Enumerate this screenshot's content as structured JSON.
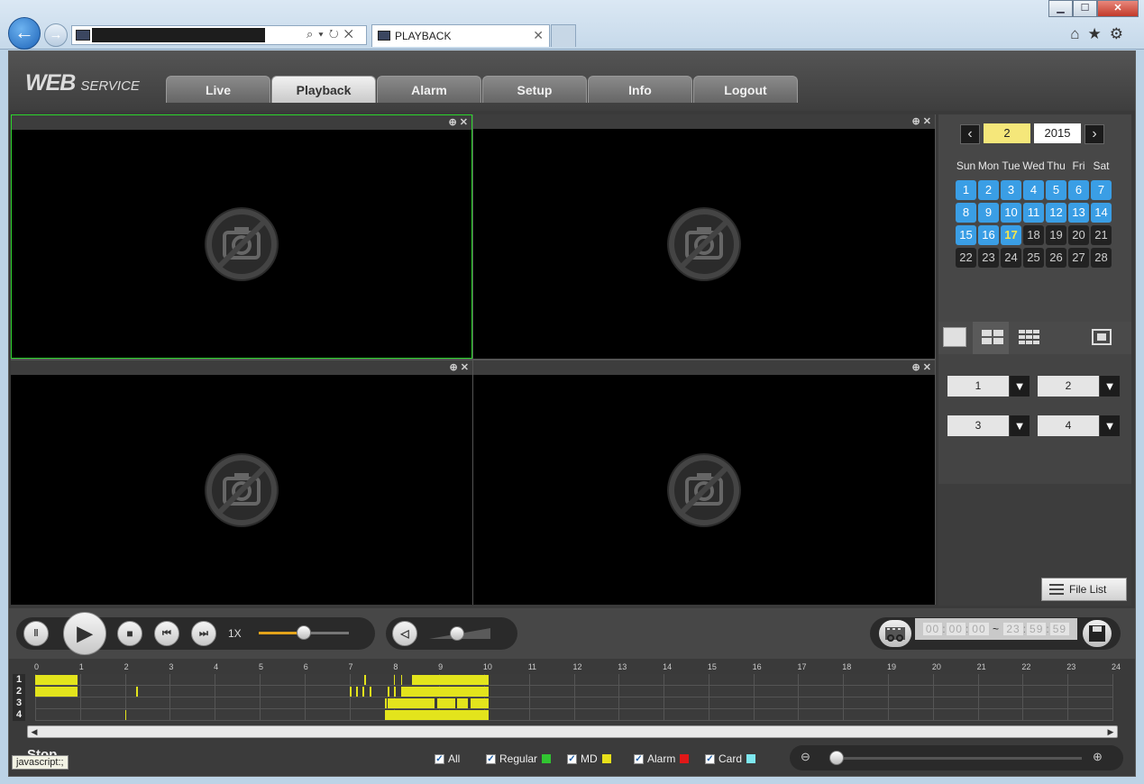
{
  "browser": {
    "tab_title": "PLAYBACK",
    "win_min": "▁",
    "win_max": "☐",
    "win_close": "✕"
  },
  "app": {
    "logo_web": "WEB",
    "logo_service": "SERVICE",
    "tabs": [
      {
        "label": "Live",
        "active": false
      },
      {
        "label": "Playback",
        "active": true
      },
      {
        "label": "Alarm",
        "active": false
      },
      {
        "label": "Setup",
        "active": false
      },
      {
        "label": "Info",
        "active": false
      },
      {
        "label": "Logout",
        "active": false
      }
    ]
  },
  "calendar": {
    "month": "2",
    "year": "2015",
    "weekdays": [
      "Sun",
      "Mon",
      "Tue",
      "Wed",
      "Thu",
      "Fri",
      "Sat"
    ],
    "days": [
      {
        "d": "1",
        "s": "rec"
      },
      {
        "d": "2",
        "s": "rec"
      },
      {
        "d": "3",
        "s": "rec"
      },
      {
        "d": "4",
        "s": "rec"
      },
      {
        "d": "5",
        "s": "rec"
      },
      {
        "d": "6",
        "s": "rec"
      },
      {
        "d": "7",
        "s": "rec"
      },
      {
        "d": "8",
        "s": "rec"
      },
      {
        "d": "9",
        "s": "rec"
      },
      {
        "d": "10",
        "s": "rec"
      },
      {
        "d": "11",
        "s": "rec"
      },
      {
        "d": "12",
        "s": "rec"
      },
      {
        "d": "13",
        "s": "rec"
      },
      {
        "d": "14",
        "s": "rec"
      },
      {
        "d": "15",
        "s": "rec"
      },
      {
        "d": "16",
        "s": "rec"
      },
      {
        "d": "17",
        "s": "today"
      },
      {
        "d": "18",
        "s": "norec"
      },
      {
        "d": "19",
        "s": "norec"
      },
      {
        "d": "20",
        "s": "norec"
      },
      {
        "d": "21",
        "s": "norec"
      },
      {
        "d": "22",
        "s": "norec"
      },
      {
        "d": "23",
        "s": "norec"
      },
      {
        "d": "24",
        "s": "norec"
      },
      {
        "d": "25",
        "s": "norec"
      },
      {
        "d": "26",
        "s": "norec"
      },
      {
        "d": "27",
        "s": "norec"
      },
      {
        "d": "28",
        "s": "norec"
      }
    ]
  },
  "channels": [
    "1",
    "2",
    "3",
    "4"
  ],
  "file_list_label": "File List",
  "playback": {
    "speed": "1X",
    "speed_level": 0.5,
    "volume_level": 0.45
  },
  "time_range": {
    "start_h": "00",
    "start_m": "00",
    "start_s": "00",
    "sep": "~",
    "end_h": "23",
    "end_m": "59",
    "end_s": "59"
  },
  "timeline": {
    "hours": [
      "0",
      "1",
      "2",
      "3",
      "4",
      "5",
      "6",
      "7",
      "8",
      "9",
      "10",
      "11",
      "12",
      "13",
      "14",
      "15",
      "16",
      "17",
      "18",
      "19",
      "20",
      "21",
      "22",
      "23",
      "24"
    ],
    "rows": [
      "1",
      "2",
      "3",
      "4"
    ],
    "recordings": [
      {
        "row": 0,
        "segments": [
          [
            0.0,
            0.95
          ],
          [
            7.33,
            7.38
          ],
          [
            8.0,
            8.02
          ],
          [
            8.15,
            8.18
          ],
          [
            8.4,
            10.1
          ]
        ]
      },
      {
        "row": 1,
        "segments": [
          [
            0.0,
            0.95
          ],
          [
            2.25,
            2.28
          ],
          [
            7.0,
            7.05
          ],
          [
            7.15,
            7.2
          ],
          [
            7.3,
            7.34
          ],
          [
            7.45,
            7.5
          ],
          [
            7.85,
            7.9
          ],
          [
            8.0,
            8.03
          ],
          [
            8.15,
            10.1
          ]
        ]
      },
      {
        "row": 2,
        "segments": [
          [
            7.8,
            7.84
          ],
          [
            7.85,
            8.9
          ],
          [
            8.95,
            9.35
          ],
          [
            9.4,
            9.65
          ],
          [
            9.7,
            10.1
          ]
        ]
      },
      {
        "row": 3,
        "segments": [
          [
            2.0,
            2.02
          ],
          [
            7.8,
            10.1
          ]
        ]
      }
    ]
  },
  "filters": [
    {
      "label": "All",
      "color": ""
    },
    {
      "label": "Regular",
      "color": "#31c531"
    },
    {
      "label": "MD",
      "color": "#e8e01a"
    },
    {
      "label": "Alarm",
      "color": "#e01818"
    },
    {
      "label": "Card",
      "color": "#7ee8f0"
    }
  ],
  "zoom_level": 0.0,
  "status_text": "Stop",
  "tooltip": "javascript:;"
}
